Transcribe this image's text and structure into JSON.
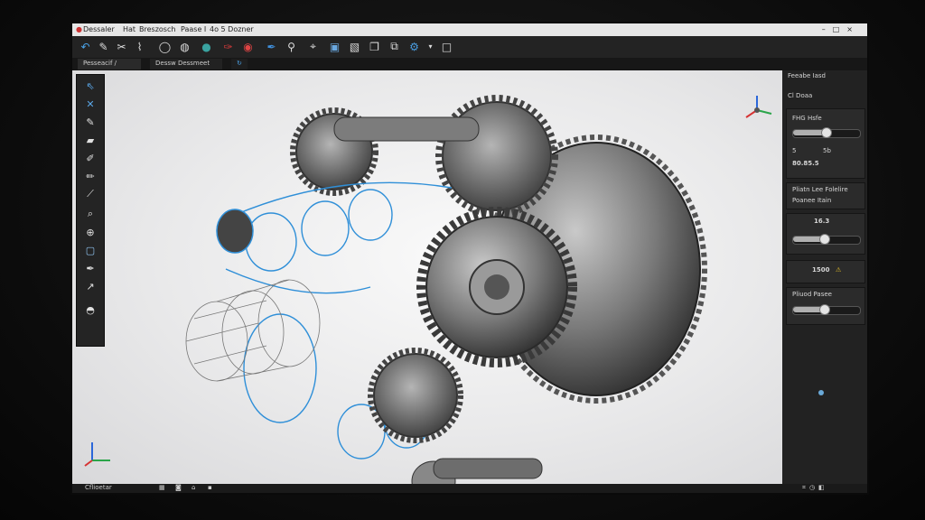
{
  "menubar": {
    "app_title": "Dessaler",
    "items": [
      "Hat",
      "Breszosch",
      "Paase I",
      "4o 5 Dozner"
    ]
  },
  "toolbar": {
    "tools": [
      "undo-icon",
      "pencil-icon",
      "scissors-icon",
      "brush-icon",
      "circle-icon",
      "sphere-icon",
      "paint-icon",
      "record-icon",
      "pen-icon",
      "picker-icon",
      "folder-icon",
      "image-icon",
      "layers-icon",
      "settings-icon",
      "dropdown-icon",
      "square-icon"
    ]
  },
  "tabs": [
    {
      "label": "Pesseacif /"
    },
    {
      "label": "Dessw Dessmeet"
    }
  ],
  "left_tools": [
    "select-icon",
    "cross-icon",
    "pencil-icon",
    "eraser-icon",
    "marker-icon",
    "brush-icon",
    "knife-icon",
    "zoom-icon",
    "zoom-fit-icon",
    "square-icon",
    "pen-icon",
    "drag-icon",
    "dome-icon"
  ],
  "right_panel": {
    "title": "Feeabe Iasd",
    "subtitle": "Cl Doaa",
    "section1_label": "FHG Hsfe",
    "value1": "80.85.5",
    "value1_prefix": "5",
    "unit1": "5b",
    "slider1": 0.48,
    "section2_title": "Pliatn Lee Folelire",
    "section2_sub": "Poanee Itain",
    "value2": "16.3",
    "slider2": 0.46,
    "value3": "1500",
    "section3_label": "Pliuod Pasee",
    "slider3": 0.46
  },
  "statusbar": {
    "left": "Cflioetar",
    "right_icons": [
      "grid-icon",
      "camera-icon",
      "home-icon",
      "square-icon"
    ]
  },
  "colors": {
    "accent_blue": "#2f8fd8",
    "warning": "#e6c02a",
    "viewport_bg": "#eaeaea"
  }
}
